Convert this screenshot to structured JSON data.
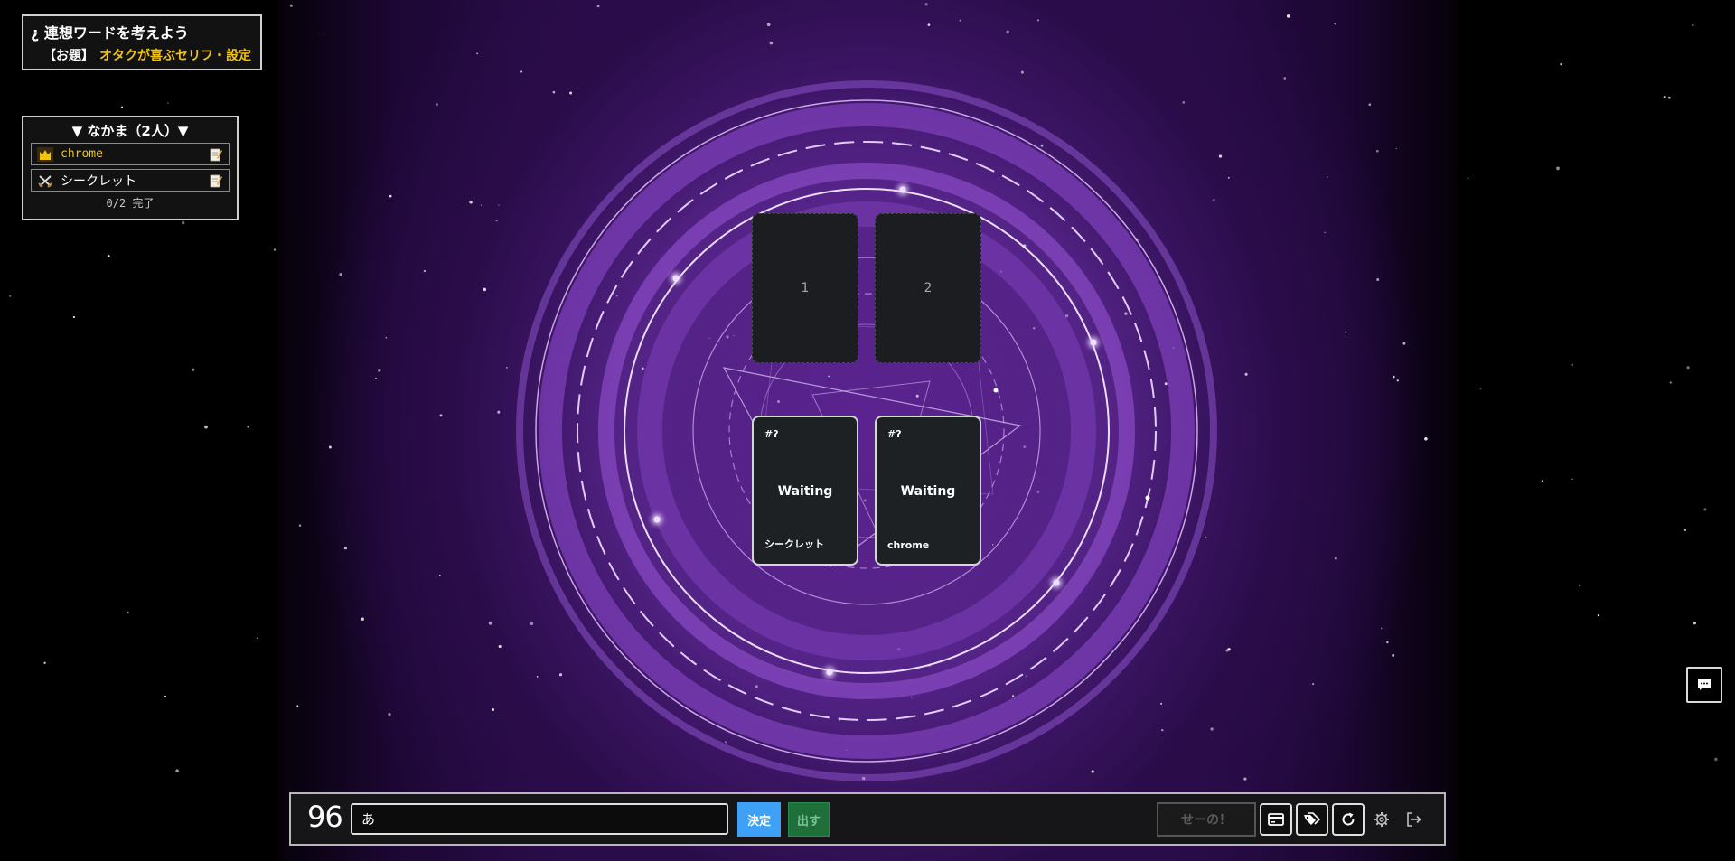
{
  "topic_panel": {
    "title": "¿ 連想ワードを考えよう",
    "label": "【お題】",
    "value": "オタクが喜ぶセリフ・設定"
  },
  "party": {
    "header": "▼ なかま（2人）▼",
    "members": [
      {
        "name": "chrome",
        "role_icon": "crown-icon",
        "role_color": "#f1c40f"
      },
      {
        "name": "シークレット",
        "role_icon": "crossed-swords-icon"
      }
    ],
    "progress": "0/2 完了"
  },
  "board": {
    "slots": [
      "1",
      "2"
    ],
    "player_cards": [
      {
        "id": "#?",
        "status": "Waiting",
        "owner": "シークレット"
      },
      {
        "id": "#?",
        "status": "Waiting",
        "owner": "chrome"
      }
    ]
  },
  "controls": {
    "timer": "96",
    "word_input_value": "あ",
    "decide_label": "決定",
    "play_label": "出す",
    "reveal_label": "せーの！",
    "icons": [
      "card-icon",
      "tag-icon",
      "refresh-icon",
      "gear-icon",
      "logout-icon"
    ]
  },
  "chat": {
    "icon": "chat-icon"
  },
  "colors": {
    "accent_yellow": "#f1c40f",
    "decide_blue": "#3fa1f5",
    "play_green": "#1f6f3b",
    "background_purple": "#461a74"
  }
}
